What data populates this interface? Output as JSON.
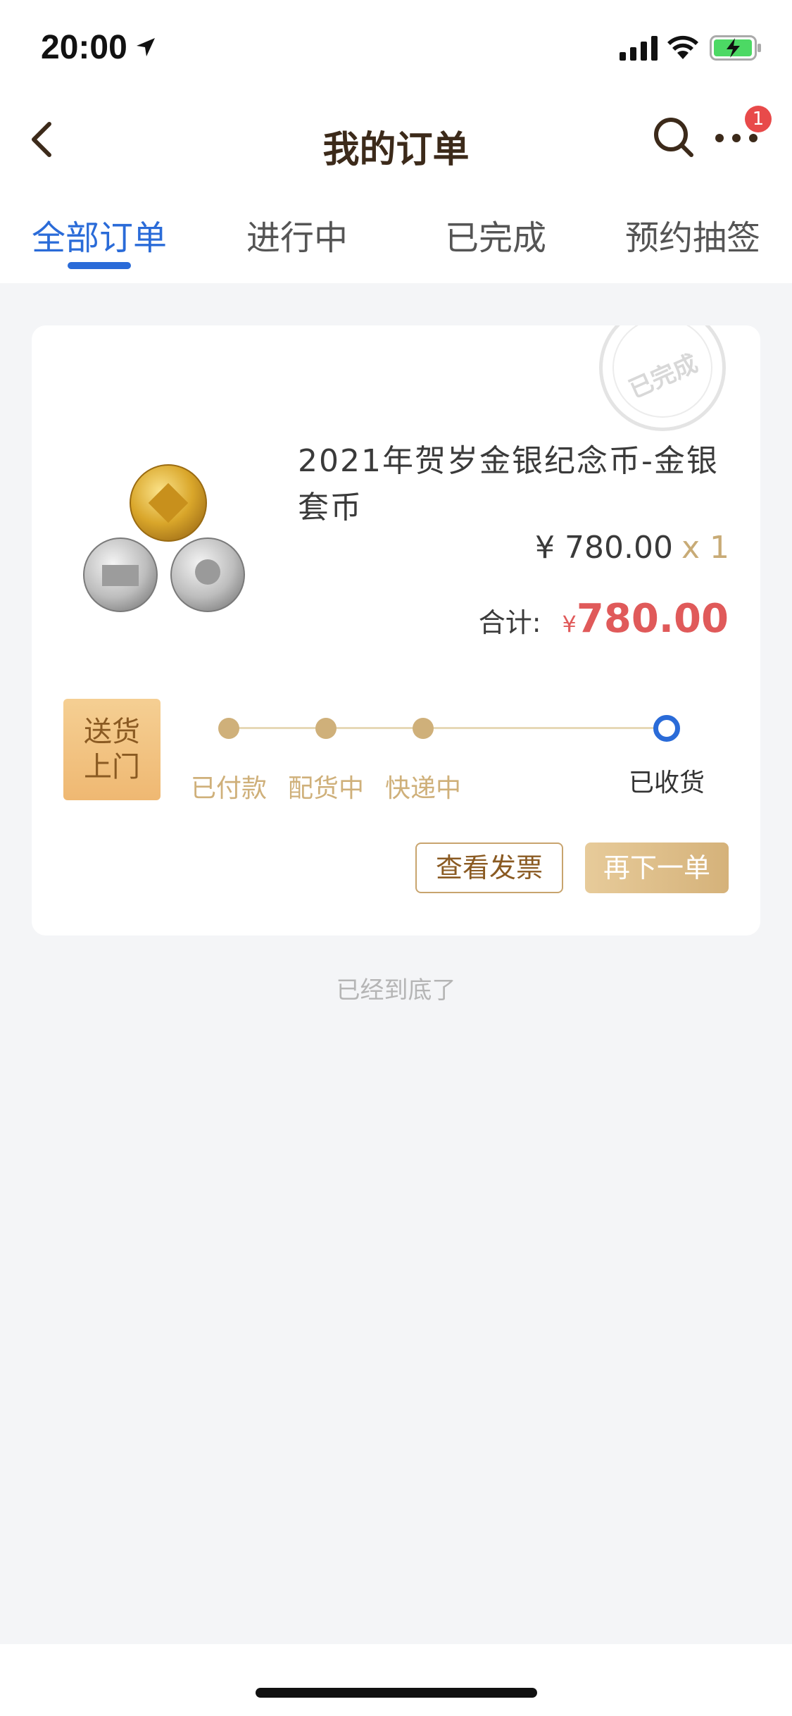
{
  "status_bar": {
    "time": "20:00"
  },
  "nav": {
    "title": "我的订单",
    "badge_count": "1"
  },
  "tabs": [
    {
      "label": "全部订单",
      "active": true
    },
    {
      "label": "进行中",
      "active": false
    },
    {
      "label": "已完成",
      "active": false
    },
    {
      "label": "预约抽签",
      "active": false
    }
  ],
  "order": {
    "stamp_text": "已完成",
    "product_name": "2021年贺岁金银纪念币-金银套币",
    "unit_price": "¥ 780.00",
    "quantity": "x 1",
    "total_label": "合计:",
    "total_currency": "¥",
    "total_amount": "780.00",
    "delivery_label_line1": "送货",
    "delivery_label_line2": "上门",
    "progress_steps": [
      "已付款",
      "配货中",
      "快递中",
      "已收货"
    ],
    "current_step_index": 3,
    "btn_invoice": "查看发票",
    "btn_reorder": "再下一单"
  },
  "footer_note": "已经到底了",
  "colors": {
    "accent_blue": "#2a6bd8",
    "gold": "#cfb07a",
    "price_red": "#e05a5a"
  }
}
